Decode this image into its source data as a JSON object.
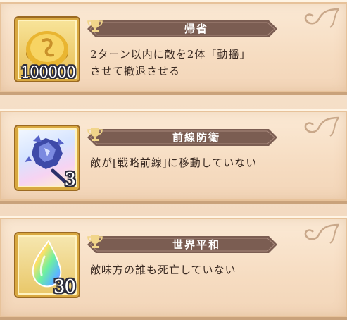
{
  "missions": [
    {
      "title": "帰省",
      "description_line1": "2ターン以内に敵を2体「動揺」",
      "description_line2": "させて撤退させる",
      "reward": {
        "icon": "gold-coin-icon",
        "count": "100000"
      }
    },
    {
      "title": "前線防衛",
      "description_line1": "敵が[戦略前線]に移動していない",
      "description_line2": "",
      "reward": {
        "icon": "crystal-axe-icon",
        "count": "3"
      }
    },
    {
      "title": "世界平和",
      "description_line1": "敵味方の誰も死亡していない",
      "description_line2": "",
      "reward": {
        "icon": "rainbow-crystal-icon",
        "count": "30"
      }
    }
  ],
  "colors": {
    "banner": "#7b5d52",
    "banner_dark": "#5a3f36",
    "trophy": "#f1d58a",
    "card_bg": "#f8e2c9",
    "text": "#3a2a22"
  }
}
